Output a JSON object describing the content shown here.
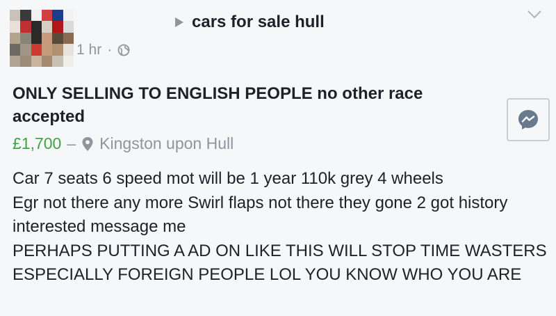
{
  "post": {
    "group_name": "cars for sale hull",
    "timestamp": "1 hr",
    "separator": "·",
    "privacy_icon": "globe-icon",
    "avatar_blurred": true
  },
  "listing": {
    "title": "ONLY SELLING TO ENGLISH PEOPLE no other race accepted",
    "price": "£1,700",
    "dash": "–",
    "location": "Kingston upon Hull",
    "description": "Car 7 seats 6 speed  mot will be 1 year 110k grey 4 wheels\nEgr not there any more Swirl flaps not there  they gone 2 got history interested message me\nPERHAPS PUTTING A AD ON LIKE THIS WILL STOP TIME WASTERS ESPECIALLY FOREIGN PEOPLE LOL YOU KNOW WHO YOU ARE"
  },
  "icons": {
    "menu": "chevron-down-icon",
    "message": "messenger-icon",
    "location": "location-pin-icon"
  },
  "colors": {
    "price": "#42a147",
    "secondary_text": "#90949c",
    "messenger_blue": "#6a7a8e",
    "background": "#f6f7f9"
  }
}
